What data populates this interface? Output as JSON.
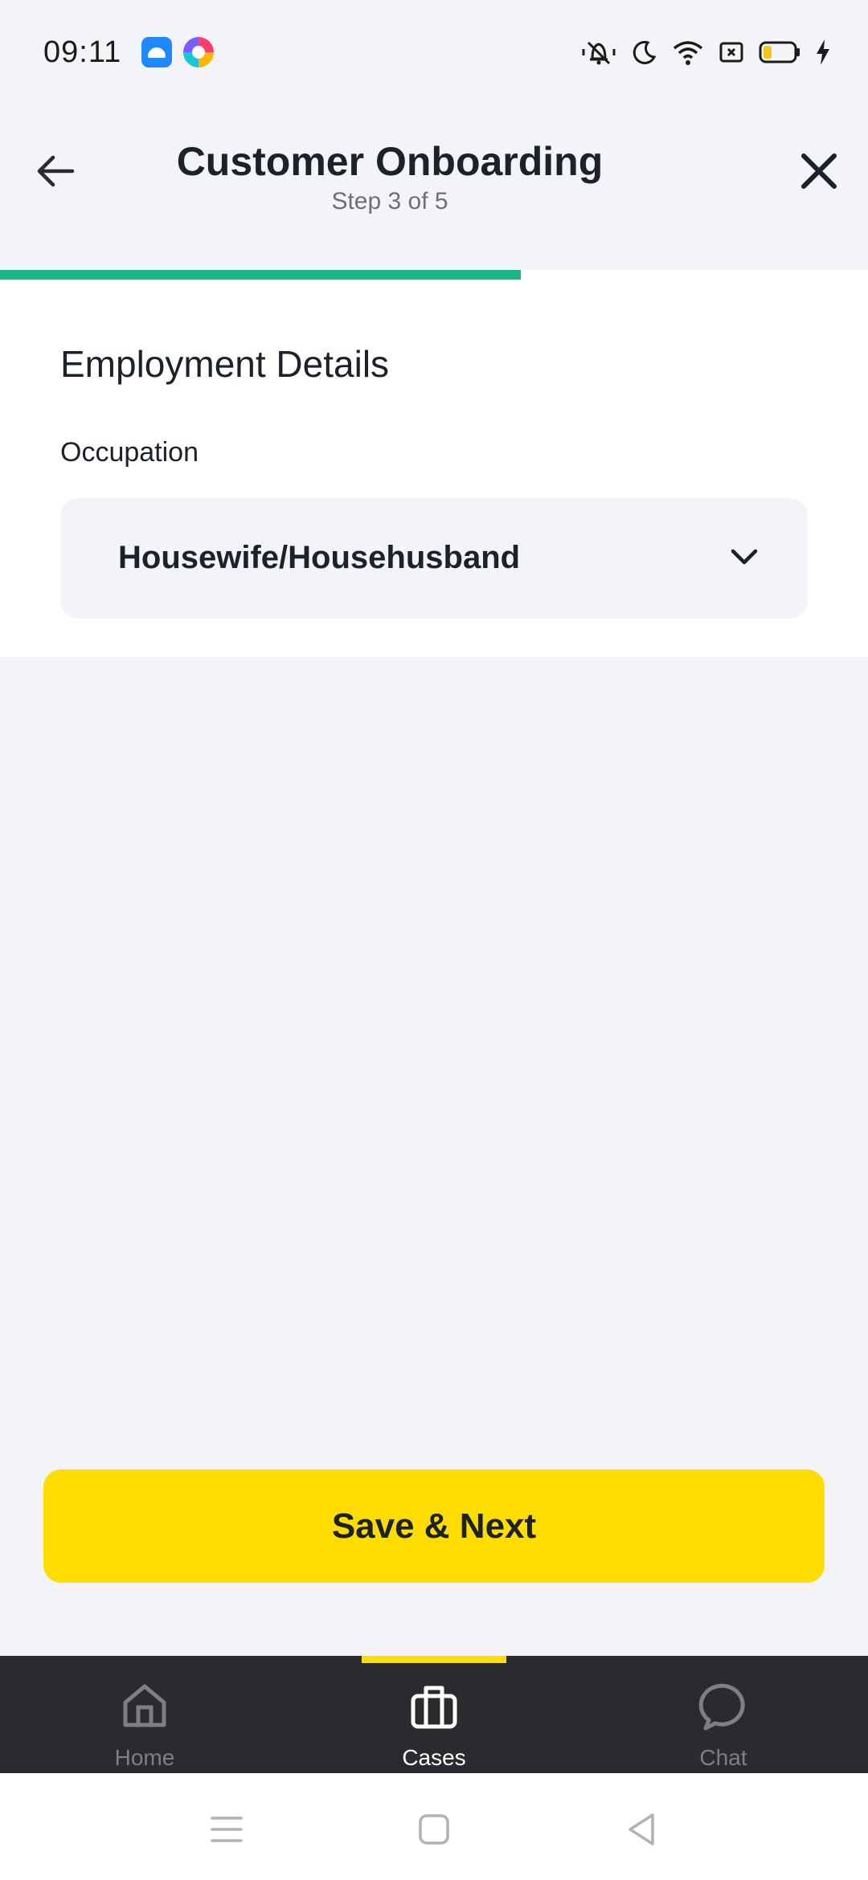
{
  "status_bar": {
    "time": "09:11",
    "app_icons": [
      "android-app-icon",
      "colorful-app-icon"
    ],
    "icons": [
      "vibrate-silent-icon",
      "moon-icon",
      "wifi-icon",
      "screen-record-icon",
      "battery-icon",
      "charging-bolt-icon"
    ],
    "battery_level": 0.18
  },
  "header": {
    "title": "Customer Onboarding",
    "subtitle": "Step 3 of 5",
    "back_icon": "arrow-left-icon",
    "close_icon": "close-icon"
  },
  "progress": {
    "current_step": 3,
    "total_steps": 5,
    "fraction": 0.6,
    "color": "#19b68a"
  },
  "form": {
    "section_title": "Employment Details",
    "fields": [
      {
        "label": "Occupation",
        "value": "Housewife/Househusband",
        "icon": "chevron-down-icon"
      }
    ]
  },
  "actions": {
    "save_next_label": "Save & Next",
    "accent_color": "#ffdd00"
  },
  "bottom_nav": {
    "active_index": 1,
    "items": [
      {
        "label": "Home",
        "icon": "home-icon"
      },
      {
        "label": "Cases",
        "icon": "briefcase-icon"
      },
      {
        "label": "Chat",
        "icon": "chat-bubble-icon"
      }
    ]
  },
  "system_nav": {
    "icons": [
      "menu-lines-icon",
      "square-home-icon",
      "triangle-back-icon"
    ]
  }
}
